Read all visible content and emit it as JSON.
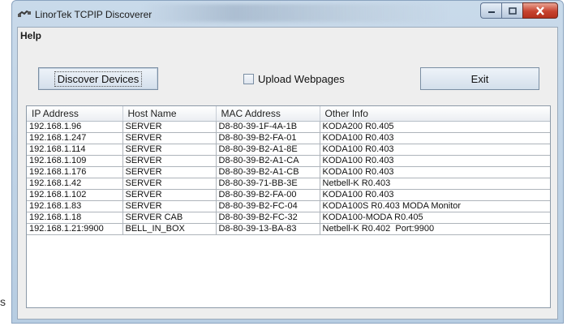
{
  "window": {
    "title": "LinorTek TCPIP Discoverer",
    "icon": "network-cable-icon"
  },
  "menu": {
    "help": "Help"
  },
  "toolbar": {
    "discover_label": "Discover Devices",
    "upload_label": "Upload Webpages",
    "upload_checked": false,
    "exit_label": "Exit"
  },
  "table": {
    "columns": [
      "IP Address",
      "Host Name",
      "MAC Address",
      "Other Info"
    ],
    "rows": [
      [
        "192.168.1.96",
        "SERVER",
        "D8-80-39-1F-4A-1B",
        "KODA200 R0.405"
      ],
      [
        "192.168.1.247",
        "SERVER",
        "D8-80-39-B2-FA-01",
        "KODA100 R0.403"
      ],
      [
        "192.168.1.114",
        "SERVER",
        "D8-80-39-B2-A1-8E",
        "KODA100 R0.403"
      ],
      [
        "192.168.1.109",
        "SERVER",
        "D8-80-39-B2-A1-CA",
        "KODA100 R0.403"
      ],
      [
        "192.168.1.176",
        "SERVER",
        "D8-80-39-B2-A1-CB",
        "KODA100 R0.403"
      ],
      [
        "192.168.1.42",
        "SERVER",
        "D8-80-39-71-BB-3E",
        "Netbell-K R0.403"
      ],
      [
        "192.168.1.102",
        "SERVER",
        "D8-80-39-B2-FA-00",
        "KODA100 R0.403"
      ],
      [
        "192.168.1.83",
        "SERVER",
        "D8-80-39-B2-FC-04",
        "KODA100S R0.403 MODA Monitor"
      ],
      [
        "192.168.1.18",
        "SERVER CAB",
        "D8-80-39-B2-FC-32",
        "KODA100-MODA R0.405"
      ],
      [
        "192.168.1.21:9900",
        "BELL_IN_BOX",
        "D8-80-39-13-BA-83",
        "Netbell-K R0.402  Port:9900"
      ]
    ]
  },
  "stray_char": "s"
}
